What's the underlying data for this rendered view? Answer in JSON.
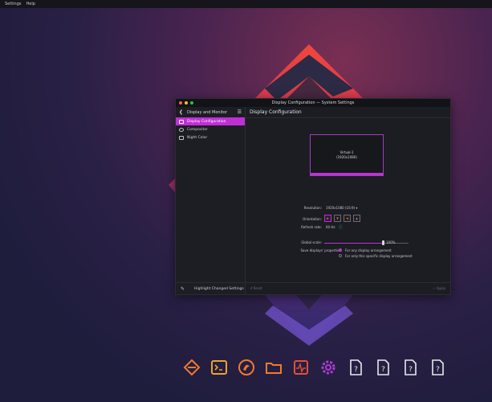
{
  "menubar": {
    "settings": "Settings",
    "help": "Help"
  },
  "window": {
    "title": "Display Configuration — System Settings"
  },
  "sidebar": {
    "header": "Display and Monitor",
    "items": [
      {
        "label": "Display Configuration",
        "selected": true
      },
      {
        "label": "Compositor",
        "selected": false
      },
      {
        "label": "Night Color",
        "selected": false
      }
    ],
    "footer": "Highlight Changed Settings"
  },
  "main": {
    "title": "Display Configuration",
    "monitor": {
      "name": "Virtual-1",
      "resolution": "(1920x1080)"
    },
    "resolution_label": "Resolution:",
    "resolution_value": "1920x1080 (16:9)",
    "orientation_label": "Orientation:",
    "refresh_label": "Refresh rate:",
    "refresh_value": "60 Hz",
    "scale_label": "Global scale:",
    "scale_value": "100%",
    "scale_fraction": 0.7,
    "save_label": "Save displays' properties:",
    "radio_any": "For any display arrangement",
    "radio_specific": "For only this specific display arrangement",
    "reset_button": "Reset",
    "apply_button": "Apply"
  },
  "colors": {
    "accent": "#c02fd6"
  }
}
